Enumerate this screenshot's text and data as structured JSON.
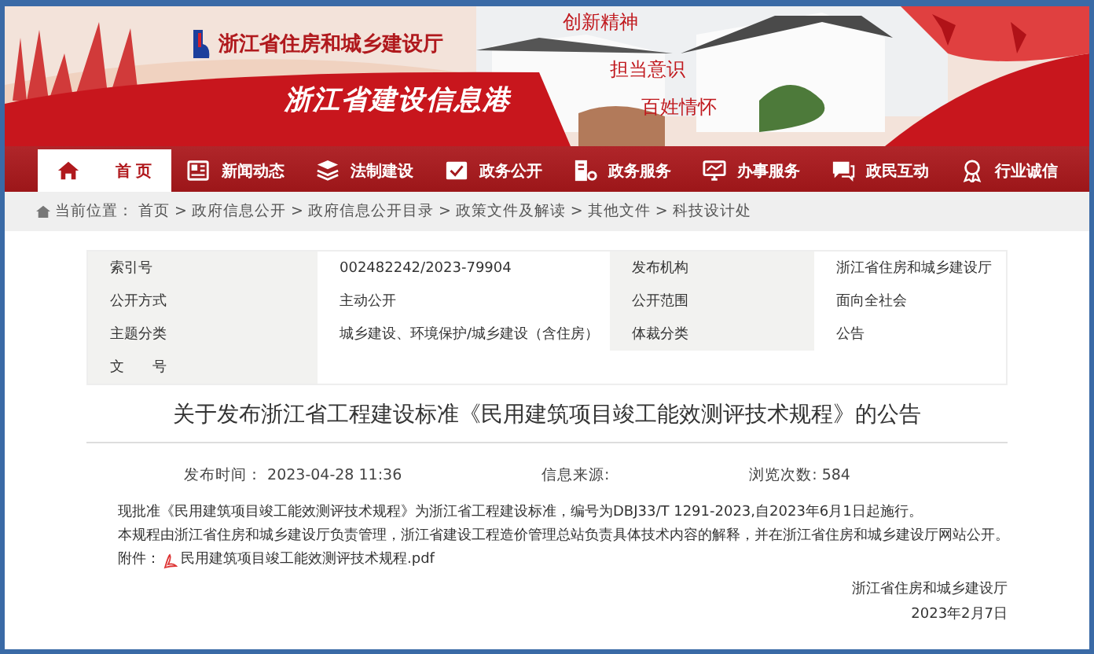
{
  "banner": {
    "agency": "浙江省住房和城乡建设厅",
    "portal": "浙江省建设信息港",
    "slogans": [
      "创新精神",
      "担当意识",
      "百姓情怀"
    ]
  },
  "nav": [
    {
      "label": "首 页",
      "selected": true
    },
    {
      "label": "新闻动态",
      "selected": false
    },
    {
      "label": "法制建设",
      "selected": false
    },
    {
      "label": "政务公开",
      "selected": false
    },
    {
      "label": "政务服务",
      "selected": false
    },
    {
      "label": "办事服务",
      "selected": false
    },
    {
      "label": "政民互动",
      "selected": false
    },
    {
      "label": "行业诚信",
      "selected": false
    }
  ],
  "breadcrumb": {
    "prefix": "当前位置：",
    "items": [
      "首页",
      "政府信息公开",
      "政府信息公开目录",
      "政策文件及解读",
      "其他文件",
      "科技设计处"
    ],
    "separator": ">"
  },
  "info_table": [
    [
      {
        "label": "索引号",
        "value": "002482242/2023-79904"
      },
      {
        "label": "发布机构",
        "value": "浙江省住房和城乡建设厅"
      }
    ],
    [
      {
        "label": "公开方式",
        "value": "主动公开"
      },
      {
        "label": "公开范围",
        "value": "面向全社会"
      }
    ],
    [
      {
        "label": "主题分类",
        "value": "城乡建设、环境保护/城乡建设（含住房）"
      },
      {
        "label": "体裁分类",
        "value": "公告"
      }
    ],
    [
      {
        "label": "文　　号"
      }
    ]
  ],
  "article": {
    "title": "关于发布浙江省工程建设标准《民用建筑项目竣工能效测评技术规程》的公告",
    "meta": [
      "发布时间：  2023-04-28 11:36",
      "信息来源:",
      "浏览次数: 584"
    ],
    "paragraphs": [
      "现批准《民用建筑项目竣工能效测评技术规程》为浙江省工程建设标准，编号为DBJ33/T 1291-2023,自2023年6月1日起施行。",
      "本规程由浙江省住房和城乡建设厅负责管理，浙江省建设工程造价管理总站负责具体技术内容的解释，并在浙江省住房和城乡建设厅网站公开。"
    ],
    "attachment": {
      "label": "附件：",
      "file": "民用建筑项目竣工能效测评技术规程.pdf"
    },
    "signature": [
      "浙江省住房和城乡建设厅",
      "2023年2月7日"
    ]
  }
}
